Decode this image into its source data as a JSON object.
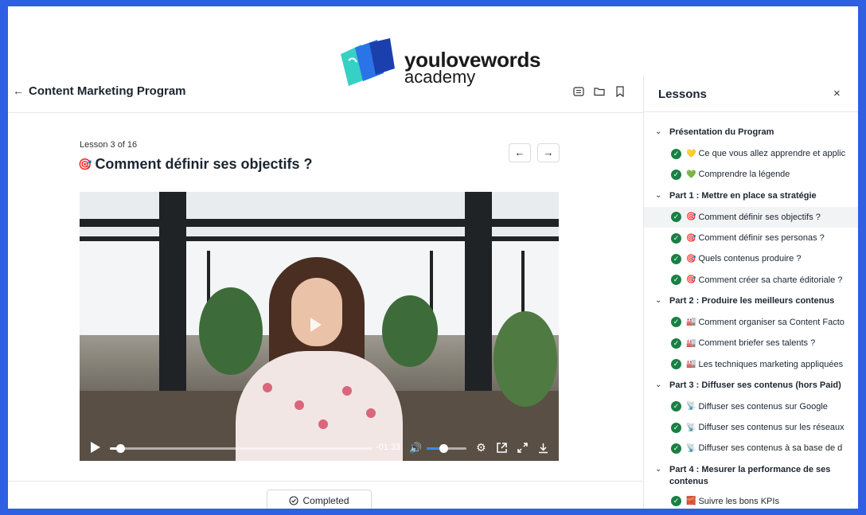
{
  "brand": {
    "name_line1": "youlovewords",
    "name_line2": "academy",
    "colors": {
      "frame": "#2f5fe3",
      "book_teal": "#36d1c4",
      "book_blue": "#2a74e8",
      "book_navy": "#1c3fae"
    }
  },
  "header": {
    "back_icon": "arrow-left-icon",
    "course_title": "Content Marketing Program",
    "icons": [
      "list-icon",
      "folder-icon",
      "bookmark-icon"
    ]
  },
  "lesson": {
    "number": "Lesson 3 of 16",
    "emoji": "🎯",
    "title": "Comment définir ses objectifs ?",
    "prev_icon": "←",
    "next_icon": "→"
  },
  "player": {
    "time_remaining": "-01:33",
    "progress_fraction": 0.03,
    "volume_fraction": 0.42,
    "icons": [
      "play-icon",
      "volume-icon",
      "settings-icon",
      "popout-icon",
      "fullscreen-icon",
      "download-icon"
    ]
  },
  "completed_label": "Completed",
  "sidebar": {
    "title": "Lessons",
    "close": "×",
    "sections": [
      {
        "label": "Présentation du Program",
        "lessons": [
          {
            "emoji": "💛",
            "label": "Ce que vous allez apprendre et applic"
          },
          {
            "emoji": "💚",
            "label": "Comprendre la légende"
          }
        ]
      },
      {
        "label": "Part 1 : Mettre en place sa stratégie",
        "lessons": [
          {
            "emoji": "🎯",
            "label": "Comment définir ses objectifs ?",
            "active": true
          },
          {
            "emoji": "🎯",
            "label": "Comment définir ses personas ?"
          },
          {
            "emoji": "🎯",
            "label": "Quels contenus produire ?"
          },
          {
            "emoji": "🎯",
            "label": "Comment créer sa charte éditoriale ?"
          }
        ]
      },
      {
        "label": "Part 2 : Produire les meilleurs contenus",
        "lessons": [
          {
            "emoji": "🏭",
            "label": "Comment organiser sa Content Facto"
          },
          {
            "emoji": "🏭",
            "label": "Comment briefer ses talents ?"
          },
          {
            "emoji": "🏭",
            "label": "Les techniques marketing appliquées"
          }
        ]
      },
      {
        "label": "Part 3 : Diffuser ses contenus (hors Paid)",
        "lessons": [
          {
            "emoji": "📡",
            "label": "Diffuser ses contenus sur Google"
          },
          {
            "emoji": "📡",
            "label": "Diffuser ses contenus sur les réseaux"
          },
          {
            "emoji": "📡",
            "label": "Diffuser ses contenus à sa base de d"
          }
        ]
      },
      {
        "label": "Part 4 : Mesurer la performance de ses contenus",
        "lessons": [
          {
            "emoji": "🧱",
            "label": "Suivre les bons KPIs"
          }
        ]
      }
    ]
  }
}
